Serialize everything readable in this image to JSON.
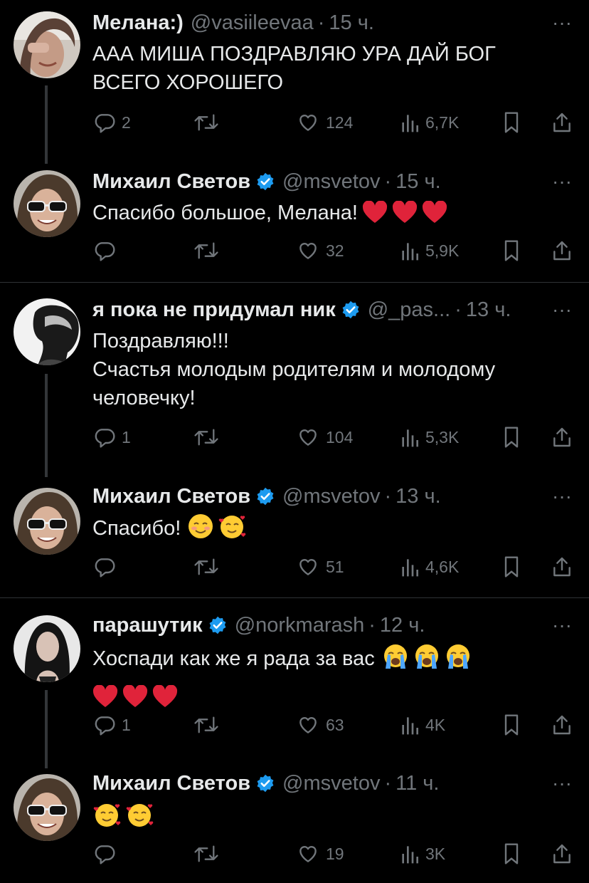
{
  "tweets": [
    {
      "name": "Мелана:)",
      "handle": "@vasiileevaa",
      "dot": "·",
      "time": "15 ч.",
      "text_lines": [
        "ААА МИША ПОЗДРАВЛЯЮ УРА ДАЙ БОГ",
        "ВСЕГО ХОРОШЕГО"
      ],
      "emoji": [],
      "replies": "2",
      "retweets": "",
      "likes": "124",
      "views": "6,7K"
    },
    {
      "name": "Михаил Светов",
      "handle": "@msvetov",
      "dot": "·",
      "time": "15 ч.",
      "text_lines": [
        "Спасибо большое, Мелана!"
      ],
      "emoji": [
        "red-heart",
        "red-heart",
        "red-heart"
      ],
      "replies": "",
      "retweets": "",
      "likes": "32",
      "views": "5,9K"
    },
    {
      "name": "я пока не придумал ник",
      "handle": "@_pas...",
      "dot": "·",
      "time": "13 ч.",
      "text_lines": [
        "Поздравляю!!!",
        "Счастья молодым родителям и молодому",
        "человечку!"
      ],
      "emoji": [],
      "replies": "1",
      "retweets": "",
      "likes": "104",
      "views": "5,3K"
    },
    {
      "name": "Михаил Светов",
      "handle": "@msvetov",
      "dot": "·",
      "time": "13 ч.",
      "text_lines": [
        "Спасибо!"
      ],
      "emoji": [
        "smiling-blush",
        "smiling-hearts"
      ],
      "replies": "",
      "retweets": "",
      "likes": "51",
      "views": "4,6K"
    },
    {
      "name": "парашутик",
      "handle": "@norkmarash",
      "dot": "·",
      "time": "12 ч.",
      "text_lines": [
        "Хоспади как же я рада за вас"
      ],
      "emoji": [
        "loudly-crying",
        "loudly-crying",
        "loudly-crying"
      ],
      "emoji2": [
        "red-heart",
        "red-heart",
        "red-heart"
      ],
      "replies": "1",
      "retweets": "",
      "likes": "63",
      "views": "4K"
    },
    {
      "name": "Михаил Светов",
      "handle": "@msvetov",
      "dot": "·",
      "time": "11 ч.",
      "text_lines": [],
      "emoji": [
        "smiling-hearts",
        "smiling-hearts"
      ],
      "replies": "",
      "retweets": "",
      "likes": "19",
      "views": "3K"
    }
  ],
  "more_label": "···",
  "colors": {
    "background": "#000000",
    "text": "#e7e9ea",
    "muted": "#71767b",
    "verified": "#1d9bf0",
    "thread_line": "#333639",
    "separator": "#2f3336",
    "heart": "#e0233a"
  },
  "icons": {
    "reply": "reply-icon",
    "retweet": "retweet-icon",
    "like": "like-icon",
    "views": "views-icon",
    "bookmark": "bookmark-icon",
    "share": "share-icon",
    "more": "more-icon",
    "verified": "verified-badge-icon"
  }
}
